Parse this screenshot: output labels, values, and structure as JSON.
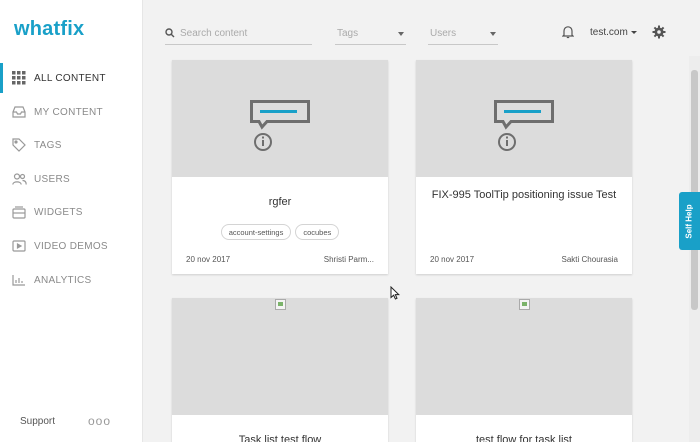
{
  "brand": {
    "logo": "whatfix",
    "accent": "#19a0c8"
  },
  "sidebar": {
    "items": [
      {
        "label": "ALL CONTENT",
        "icon": "grid-icon",
        "active": true
      },
      {
        "label": "MY CONTENT",
        "icon": "inbox-icon",
        "active": false
      },
      {
        "label": "TAGS",
        "icon": "tag-icon",
        "active": false
      },
      {
        "label": "USERS",
        "icon": "users-icon",
        "active": false
      },
      {
        "label": "WIDGETS",
        "icon": "widgets-icon",
        "active": false
      },
      {
        "label": "VIDEO DEMOS",
        "icon": "video-icon",
        "active": false
      },
      {
        "label": "ANALYTICS",
        "icon": "analytics-icon",
        "active": false
      }
    ],
    "support_label": "Support",
    "more_label": "ooo"
  },
  "topbar": {
    "search_placeholder": "Search content",
    "tags_label": "Tags",
    "users_label": "Users",
    "account_label": "test.com"
  },
  "cards": [
    {
      "title": "rgfer",
      "tags": [
        "account-settings",
        "cocubes"
      ],
      "date": "20 nov 2017",
      "author": "Shristi Parm..."
    },
    {
      "title": "FIX-995 ToolTip positioning issue Test",
      "tags": [],
      "date": "20 nov 2017",
      "author": "Sakti Chourasia"
    },
    {
      "title": "Task list test flow"
    },
    {
      "title": "test flow for task list"
    }
  ],
  "self_help_label": "Self Help"
}
